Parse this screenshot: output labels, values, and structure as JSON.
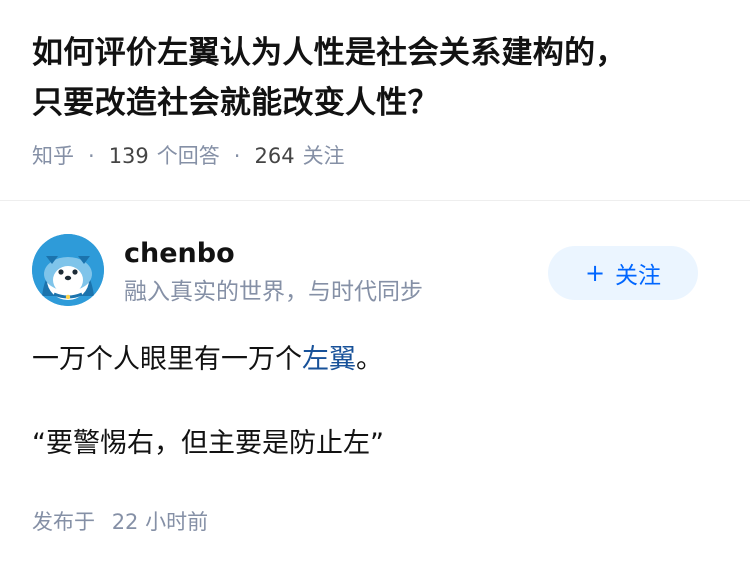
{
  "question": {
    "title_line1": "如何评价左翼认为人性是社会关系建构的，",
    "title_line2": "只要改造社会就能改变人性？",
    "source": "知乎",
    "separator": "·",
    "answer_count": "139",
    "answer_label": "个回答",
    "follower_count": "264",
    "follower_label": "关注"
  },
  "author": {
    "name": "chenbo",
    "bio": "融入真实的世界，与时代同步",
    "avatar_icon": "mascot-avatar",
    "follow_plus": "+",
    "follow_label": "关注"
  },
  "answer": {
    "p1_before": "一万个人眼里有一万个",
    "p1_link": "左翼",
    "p1_after": "。",
    "p2": "“要警惕右，但主要是防止左”"
  },
  "footer": {
    "published_label": "发布于",
    "published_time": "22 小时前"
  },
  "colors": {
    "accent": "#0066ff",
    "link": "#175199",
    "meta_gray": "#8590a6",
    "follow_bg": "#ebf5ff"
  }
}
